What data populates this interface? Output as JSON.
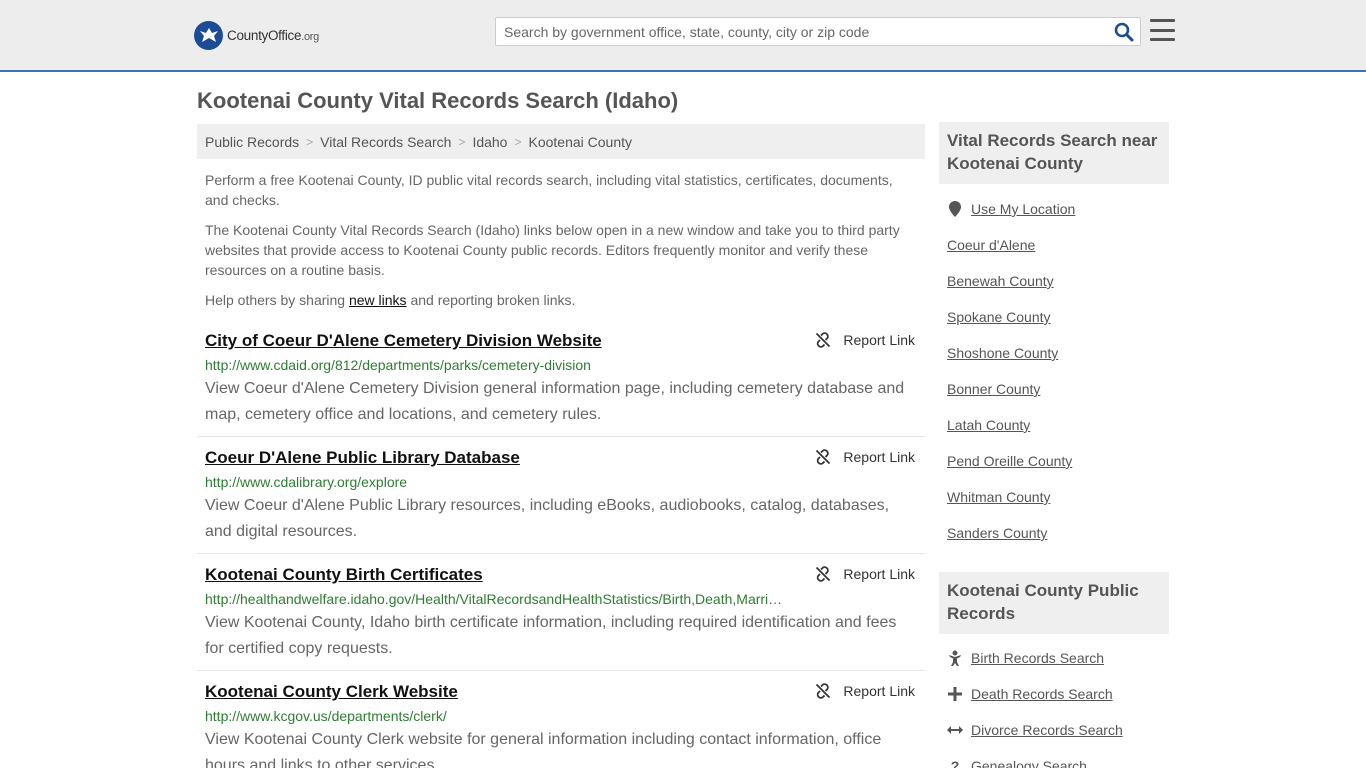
{
  "header": {
    "logo_main": "CountyOffice",
    "logo_suffix": ".org",
    "search_placeholder": "Search by government office, state, county, city or zip code"
  },
  "page_title": "Kootenai County Vital Records Search (Idaho)",
  "breadcrumb": [
    "Public Records",
    "Vital Records Search",
    "Idaho",
    "Kootenai County"
  ],
  "intro": {
    "p1": "Perform a free Kootenai County, ID public vital records search, including vital statistics, certificates, documents, and checks.",
    "p2": "The Kootenai County Vital Records Search (Idaho) links below open in a new window and take you to third party websites that provide access to Kootenai County public records. Editors frequently monitor and verify these resources on a routine basis.",
    "p3_before": "Help others by sharing ",
    "p3_link": "new links",
    "p3_after": " and reporting broken links."
  },
  "report_label": "Report Link",
  "results": [
    {
      "title": "City of Coeur D'Alene Cemetery Division Website",
      "url": "http://www.cdaid.org/812/departments/parks/cemetery-division",
      "desc": "View Coeur d'Alene Cemetery Division general information page, including cemetery database and map, cemetery office and locations, and cemetery rules."
    },
    {
      "title": "Coeur D'Alene Public Library Database",
      "url": "http://www.cdalibrary.org/explore",
      "desc": "View Coeur d'Alene Public Library resources, including eBooks, audiobooks, catalog, databases, and digital resources."
    },
    {
      "title": "Kootenai County Birth Certificates",
      "url": "http://healthandwelfare.idaho.gov/Health/VitalRecordsandHealthStatistics/Birth,Death,Marri…",
      "desc": "View Kootenai County, Idaho birth certificate information, including required identification and fees for certified copy requests."
    },
    {
      "title": "Kootenai County Clerk Website",
      "url": "http://www.kcgov.us/departments/clerk/",
      "desc": "View Kootenai County Clerk website for general information including contact information, office hours and links to other services."
    }
  ],
  "sidebar": {
    "nearby_title": "Vital Records Search near Kootenai County",
    "use_location": "Use My Location",
    "nearby": [
      "Coeur d'Alene",
      "Benewah County",
      "Spokane County",
      "Shoshone County",
      "Bonner County",
      "Latah County",
      "Pend Oreille County",
      "Whitman County",
      "Sanders County"
    ],
    "public_title": "Kootenai County Public Records",
    "public": [
      {
        "label": "Birth Records Search",
        "icon": "baby-icon"
      },
      {
        "label": "Death Records Search",
        "icon": "cross-icon"
      },
      {
        "label": "Divorce Records Search",
        "icon": "split-arrows-icon"
      },
      {
        "label": "Genealogy Search",
        "icon": "question-icon"
      }
    ]
  },
  "colors": {
    "accent": "#3f6fb5",
    "url_green": "#2e7d32",
    "logo_blue": "#1c4c94"
  }
}
